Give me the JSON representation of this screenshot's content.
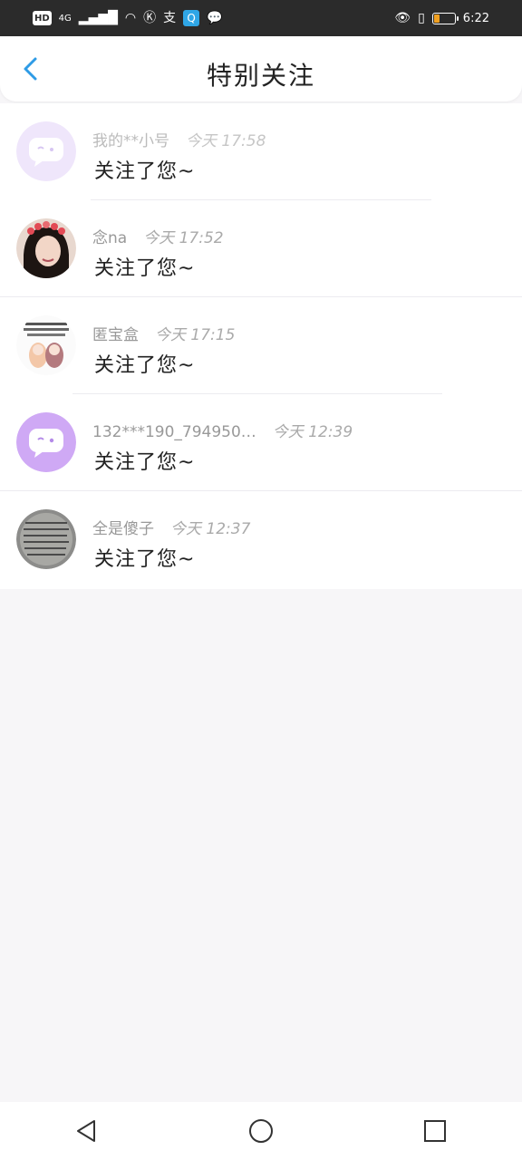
{
  "status_bar": {
    "left_items": [
      "HD",
      "4G"
    ],
    "time": "6:22",
    "battery_level": 0.2
  },
  "header": {
    "title": "特别关注",
    "back_icon": "chevron-left-icon"
  },
  "items": [
    {
      "name": "我的**小号",
      "time": "今天 17:58",
      "message": "关注了您~",
      "avatar_type": "app-logo",
      "name_muted": true
    },
    {
      "name": "念na",
      "time": "今天 17:52",
      "message": "关注了您~",
      "avatar_type": "photo-person"
    },
    {
      "name": "匿宝盒",
      "time": "今天 17:15",
      "message": "关注了您~",
      "avatar_type": "illustration"
    },
    {
      "name": "132***190_794950…",
      "time": "今天 12:39",
      "message": "关注了您~",
      "avatar_type": "app-logo"
    },
    {
      "name": "全是傻子",
      "time": "今天 12:37",
      "message": "关注了您~",
      "avatar_type": "photo-paper"
    }
  ],
  "colors": {
    "accent": "#2e9be6",
    "logo_bg": "#efe6fb",
    "logo_purple": "#c9a8f2"
  }
}
